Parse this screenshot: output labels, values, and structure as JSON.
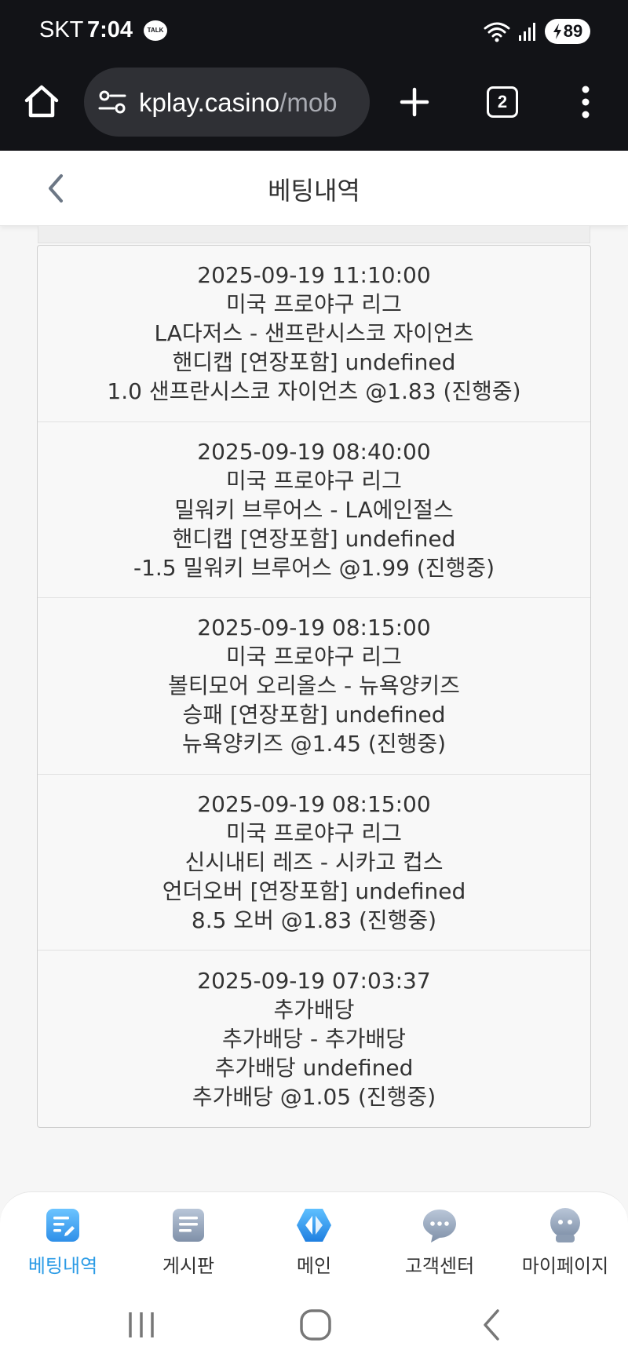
{
  "status_bar": {
    "carrier": "SKT",
    "time": "7:04",
    "talk_badge": "TALK",
    "battery": "89"
  },
  "browser": {
    "url_main": "kplay.casino",
    "url_path": "/mob",
    "tab_count": "2"
  },
  "header": {
    "title": "베팅내역"
  },
  "bets": [
    {
      "datetime": "2025-09-19 11:10:00",
      "league": "미국 프로야구 리그",
      "match": "LA다저스 - 샌프란시스코 자이언츠",
      "market": "핸디캡 [연장포함] undefined",
      "pick": "1.0 샌프란시스코 자이언츠 @1.83 (진행중)"
    },
    {
      "datetime": "2025-09-19 08:40:00",
      "league": "미국 프로야구 리그",
      "match": "밀워키 브루어스 - LA에인절스",
      "market": "핸디캡 [연장포함] undefined",
      "pick": "-1.5 밀워키 브루어스 @1.99 (진행중)"
    },
    {
      "datetime": "2025-09-19 08:15:00",
      "league": "미국 프로야구 리그",
      "match": "볼티모어 오리올스 - 뉴욕양키즈",
      "market": "승패 [연장포함] undefined",
      "pick": "뉴욕양키즈 @1.45 (진행중)"
    },
    {
      "datetime": "2025-09-19 08:15:00",
      "league": "미국 프로야구 리그",
      "match": "신시내티 레즈 - 시카고 컵스",
      "market": "언더오버 [연장포함] undefined",
      "pick": "8.5 오버 @1.83 (진행중)"
    },
    {
      "datetime": "2025-09-19 07:03:37",
      "league": "추가배당",
      "match": "추가배당 - 추가배당",
      "market": "추가배당 undefined",
      "pick": "추가배당 @1.05 (진행중)"
    }
  ],
  "bottom_nav": [
    {
      "label": "베팅내역",
      "icon": "betting-history-icon",
      "active": true
    },
    {
      "label": "게시판",
      "icon": "board-icon",
      "active": false
    },
    {
      "label": "메인",
      "icon": "main-diamond-icon",
      "active": false
    },
    {
      "label": "고객센터",
      "icon": "customer-center-icon",
      "active": false
    },
    {
      "label": "마이페이지",
      "icon": "my-page-icon",
      "active": false
    }
  ],
  "colors": {
    "status_bar_bg": "#121317",
    "accent_blue": "#2b9be6",
    "card_bg": "#f8f8f8"
  }
}
